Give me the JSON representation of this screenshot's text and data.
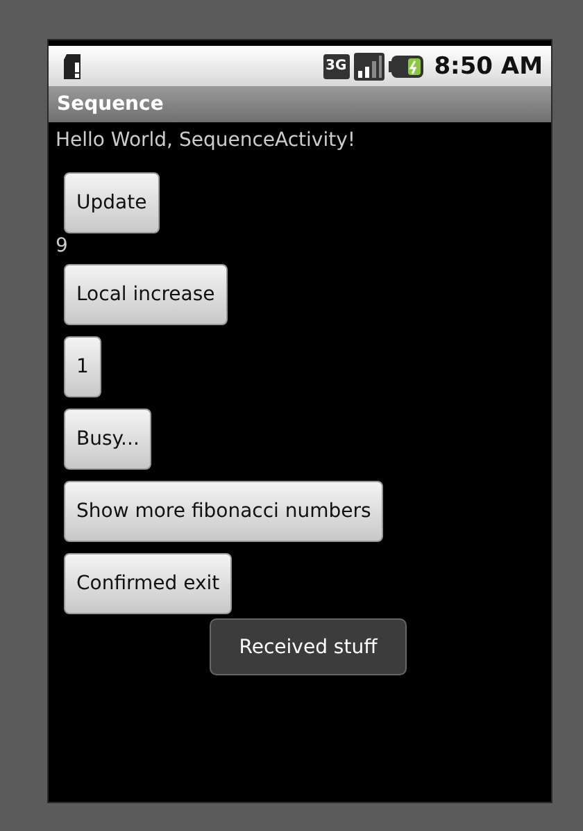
{
  "status_bar": {
    "network": "3G",
    "time": "8:50 AM"
  },
  "title_bar": {
    "title": "Sequence"
  },
  "content": [
    {
      "kind": "text",
      "text": "Hello World, SequenceActivity!"
    },
    {
      "kind": "button",
      "label": "Update"
    },
    {
      "kind": "text",
      "text": "9"
    },
    {
      "kind": "button",
      "label": "Local increase"
    },
    {
      "kind": "button",
      "label": "1"
    },
    {
      "kind": "button",
      "label": "Busy..."
    },
    {
      "kind": "button",
      "label": "Show more fibonacci numbers"
    },
    {
      "kind": "button",
      "label": "Confirmed exit"
    }
  ],
  "toast": {
    "text": "Received stuff"
  }
}
